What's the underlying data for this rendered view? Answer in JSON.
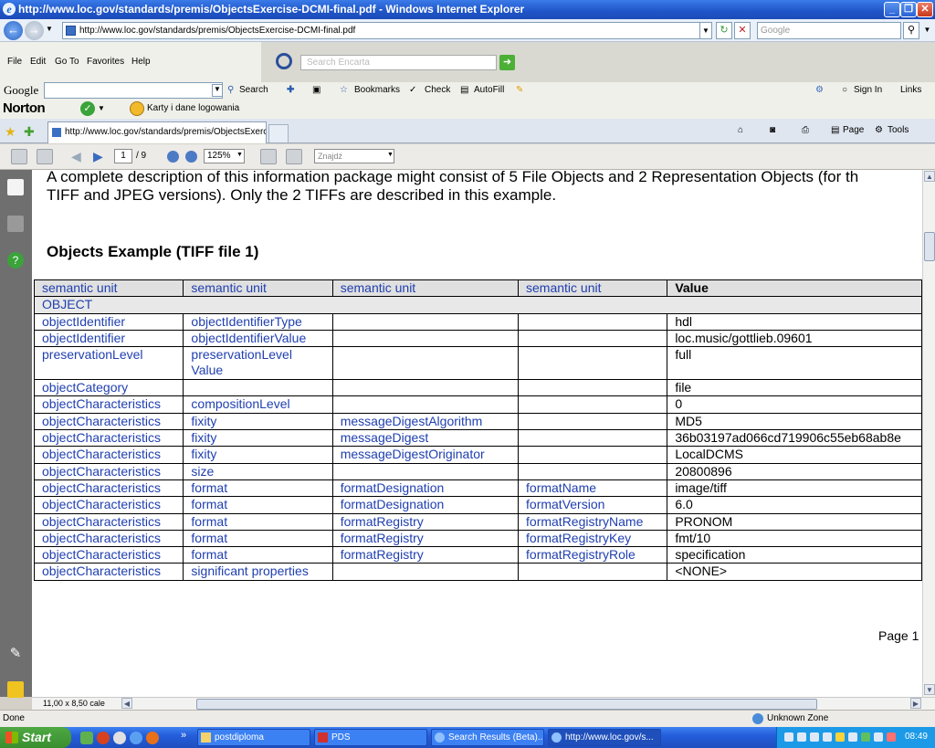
{
  "window": {
    "title": "http://www.loc.gov/standards/premis/ObjectsExercise-DCMI-final.pdf - Windows Internet Explorer",
    "url": "http://www.loc.gov/standards/premis/ObjectsExercise-DCMI-final.pdf",
    "search_placeholder": "Google"
  },
  "menu": {
    "items": [
      "File",
      "Edit",
      "Go To",
      "Favorites",
      "Help"
    ],
    "encarta_placeholder": "Search Encarta"
  },
  "google_toolbar": {
    "logo": "Google",
    "search": "Search",
    "bookmarks": "Bookmarks",
    "check": "Check",
    "autofill": "AutoFill",
    "sign_in": "Sign In",
    "links": "Links"
  },
  "norton": {
    "logo": "Norton",
    "karty": "Karty i dane logowania"
  },
  "tabs": {
    "active_label": "http://www.loc.gov/standards/premis/ObjectsExercis...",
    "page": "Page",
    "tools": "Tools"
  },
  "pdf_toolbar": {
    "page_current": "1",
    "page_total": "/ 9",
    "zoom": "125%",
    "find_placeholder": "Znajdź"
  },
  "document": {
    "intro_line1": "A complete description of this information package might consist of 5 File Objects and 2 Representation Objects (for th",
    "intro_line2": "TIFF and JPEG versions).  Only the 2 TIFFs are described in this example.",
    "heading": "Objects Example (TIFF file 1)",
    "table_headers": [
      "semantic unit",
      "semantic unit",
      "semantic unit",
      "semantic unit",
      "Value"
    ],
    "object_row": "OBJECT",
    "rows": [
      [
        "objectIdentifier",
        "objectIdentifierType",
        "",
        "",
        "hdl"
      ],
      [
        "objectIdentifier",
        "objectIdentifierValue",
        "",
        "",
        "loc.music/gottlieb.09601"
      ],
      [
        "preservationLevel",
        "preservationLevel Value",
        "",
        "",
        "full"
      ],
      [
        "objectCategory",
        "",
        "",
        "",
        "file"
      ],
      [
        "objectCharacteristics",
        "compositionLevel",
        "",
        "",
        "0"
      ],
      [
        "objectCharacteristics",
        "fixity",
        "messageDigestAlgorithm",
        "",
        "MD5"
      ],
      [
        "objectCharacteristics",
        "fixity",
        "messageDigest",
        "",
        "36b03197ad066cd719906c55eb68ab8e"
      ],
      [
        "objectCharacteristics",
        "fixity",
        "messageDigestOriginator",
        "",
        "LocalDCMS"
      ],
      [
        "objectCharacteristics",
        "size",
        "",
        "",
        "20800896"
      ],
      [
        "objectCharacteristics",
        "format",
        "formatDesignation",
        "formatName",
        "image/tiff"
      ],
      [
        "objectCharacteristics",
        "format",
        "formatDesignation",
        "formatVersion",
        "6.0"
      ],
      [
        "objectCharacteristics",
        "format",
        "formatRegistry",
        "formatRegistryName",
        "PRONOM"
      ],
      [
        "objectCharacteristics",
        "format",
        "formatRegistry",
        "formatRegistryKey",
        "fmt/10"
      ],
      [
        "objectCharacteristics",
        "format",
        "formatRegistry",
        "formatRegistryRole",
        "specification"
      ],
      [
        "objectCharacteristics",
        "significant properties",
        "",
        "",
        "<NONE>"
      ]
    ],
    "page_label": "Page 1"
  },
  "pdf_status": {
    "page_size": "11,00 x 8,50 cale"
  },
  "status": {
    "left": "Done",
    "zone": "Unknown Zone"
  },
  "taskbar": {
    "start": "Start",
    "items": [
      "postdiploma",
      "PDS",
      "Search Results (Beta)...",
      "http://www.loc.gov/s..."
    ],
    "clock": "08:49"
  },
  "colors": {
    "link_blue": "#1f3fb0",
    "titlebar": "#1f54c8",
    "taskbar": "#245edb",
    "start_green": "#3a8e2f"
  }
}
